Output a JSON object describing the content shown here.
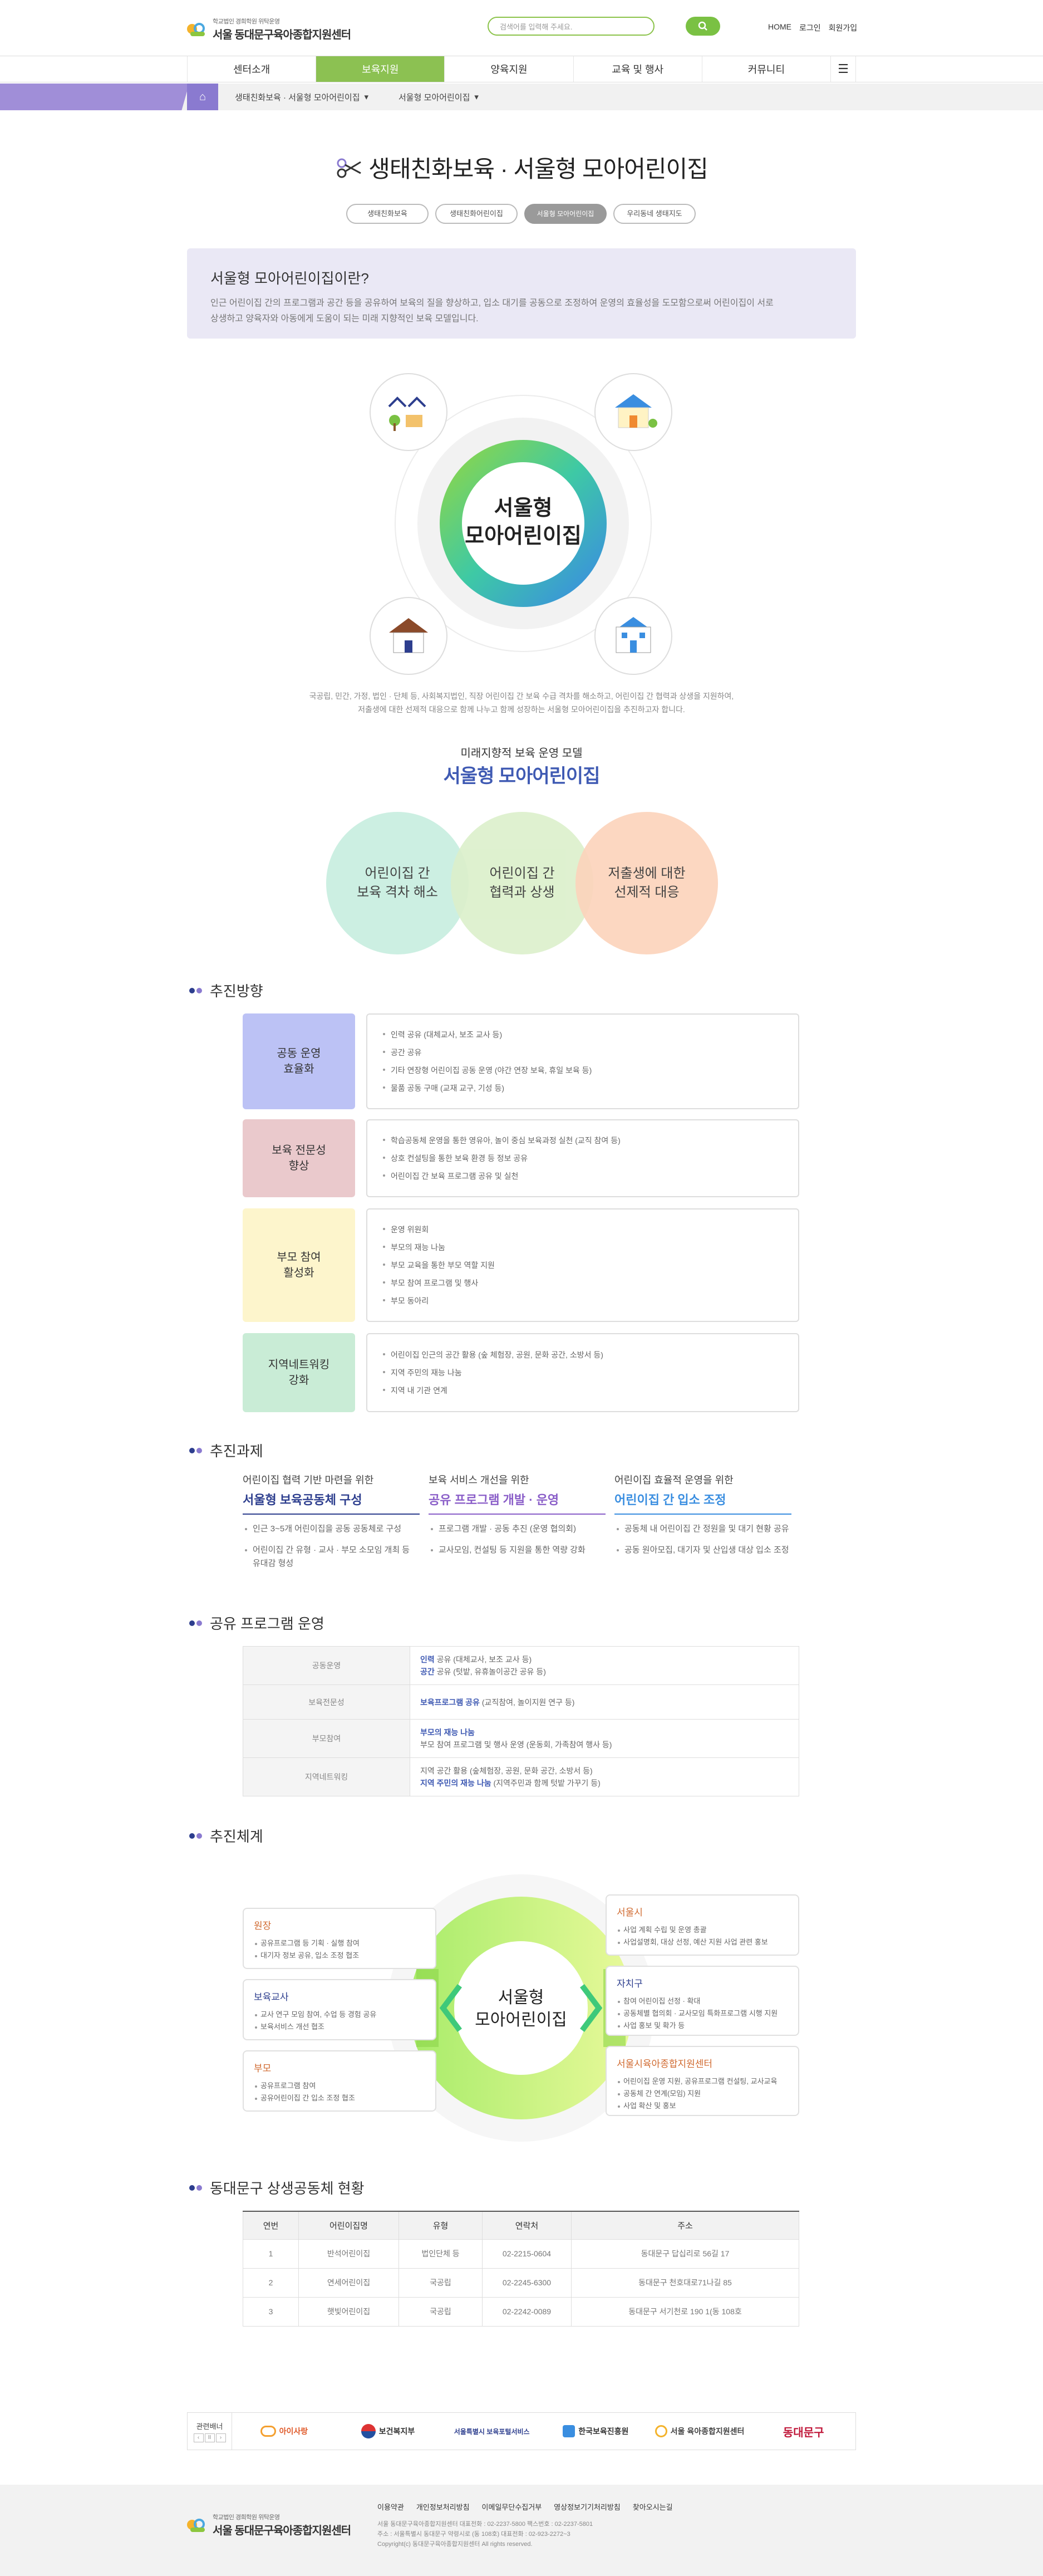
{
  "header": {
    "logo_small": "학교법인 경희학원 위탁운영",
    "logo_main": "서울 동대문구육아종합지원센터",
    "search_placeholder": "검색어를 입력해 주세요.",
    "util": [
      "HOME",
      "로그인",
      "회원가입"
    ]
  },
  "gnb": [
    "센터소개",
    "보육지원",
    "양육지원",
    "교육 및 행사",
    "커뮤니티"
  ],
  "breadcrumb": [
    "생태친화보육 · 서울형 모아어린이집",
    "서울형 모아어린이집"
  ],
  "page_title": "생태친화보육 · 서울형 모아어린이집",
  "subtabs": [
    "생태친화보육",
    "생태친화어린이집",
    "서울형 모아어린이집",
    "우리동네 생태지도"
  ],
  "intro": {
    "heading": "서울형 모아어린이집이란?",
    "text1": "인근 어린이집 간의 프로그램과 공간 등을 공유하여 보육의 질을 향상하고, 입소 대기를 공동으로 조정하여 운영의 효율성을 도모함으로써 어린이집이 서로",
    "text2": "상생하고 양육자와 아동에게 도움이 되는 미래 지향적인 보육 모델입니다."
  },
  "diagram": {
    "center1": "서울형",
    "center2": "모아어린이집",
    "note1": "국공립, 민간, 가정, 법인 · 단체 등, 사회복지법인, 직장 어린이집 간 보육 수급 격차를 해소하고, 어린이집 간 협력과 상생을 지원하여,",
    "note2": "저출생에 대한 선제적 대응으로 함께 나누고 함께 성장하는 서울형 모아어린이집을 추진하고자 합니다."
  },
  "model": {
    "sub": "미래지향적 보육 운영 모델",
    "title": "서울형 모아어린이집",
    "circles": [
      "어린이집 간\n보육 격차 해소",
      "어린이집 간\n협력과 상생",
      "저출생에 대한\n선제적 대응"
    ]
  },
  "sections": {
    "direction": "추진방향",
    "tasks": "추진과제",
    "shared": "공유 프로그램 운영",
    "system": "추진체계",
    "status": "동대문구 상생공동체 현황"
  },
  "direction_rows": [
    {
      "label": "공동 운영\n효율화",
      "items": [
        "인력 공유 (대체교사, 보조 교사 등)",
        "공간 공유",
        "기타 연장형 어린이집 공동 운영 (야간 연장 보육, 휴일 보육 등)",
        "물품 공동 구매 (교재 교구, 기성 등)"
      ]
    },
    {
      "label": "보육 전문성\n향상",
      "items": [
        "학습공동체 운영을 통한 영유아, 놀이 중심 보육과정 실천 (교직 참여 등)",
        "상호 컨설팅을 통한 보육 환경 등 정보 공유",
        "어린이집 간 보육 프로그램 공유 및 실천"
      ]
    },
    {
      "label": "부모 참여\n활성화",
      "items": [
        "운영 위원회",
        "부모의 재능 나눔",
        "부모 교육을 통한 부모 역할 지원",
        "부모 참여 프로그램 및 행사",
        "부모 동아리"
      ]
    },
    {
      "label": "지역네트워킹\n강화",
      "items": [
        "어린이집 인근의 공간 활용 (숲 체험장, 공원, 문화 공간, 소방서 등)",
        "지역 주민의 재능 나눔",
        "지역 내 기관 연계"
      ]
    }
  ],
  "tasks": [
    {
      "t1": "어린이집 협력 기반 마련을 위한",
      "t2": "서울형 보육공동체 구성",
      "items": [
        "인근 3~5개 어린이집을 공동 공동체로 구성",
        "어린이집 간 유형 · 교사 · 부모 소모임 개최 등 유대감 형성"
      ]
    },
    {
      "t1": "보육 서비스 개선을 위한",
      "t2": "공유 프로그램 개발 · 운영",
      "items": [
        "프로그램 개발 · 공동 추진 (운영 협의회)",
        "교사모임, 컨설팅 등 지원을 통한 역량 강화"
      ]
    },
    {
      "t1": "어린이집 효율적 운영을 위한",
      "t2": "어린이집 간 입소 조정",
      "items": [
        "공동체 내 어린이집 간 정원을 및 대기 현황 공유",
        "공동 원아모집, 대기자 및 산입생 대상 입소 조정"
      ]
    }
  ],
  "shared_rows": [
    {
      "k": "공동운영",
      "l1b": "인력",
      "l1": " 공유 (대체교사, 보조 교사 등)",
      "l2b": "공간",
      "l2": " 공유 (텃밭, 유휴놀이공간 공유 등)"
    },
    {
      "k": "보육전문성",
      "l1b": "보육프로그램 공유",
      "l1": " (교직참여, 놀이지원 연구 등)",
      "l2b": "",
      "l2": ""
    },
    {
      "k": "부모참여",
      "l1b": "부모의 재능 나눔",
      "l1": "",
      "l2b": "",
      "l2": "부모 참여 프로그램 및 행사 운영 (운동회, 가족참여 행사 등)"
    },
    {
      "k": "지역네트워킹",
      "l1b": "",
      "l1": "지역 공간 활용 (숲체험장, 공원, 문화 공간, 소방서 등)",
      "l2b": "지역 주민의 재능 나눔",
      "l2": " (지역주민과 함께 텃밭 가꾸기 등)"
    }
  ],
  "system": {
    "center1": "서울형",
    "center2": "모아어린이집",
    "left": [
      {
        "title": "원장",
        "items": [
          "공유프로그램 등 기획 · 실행 참여",
          "대기자 정보 공유, 입소 조정 협조"
        ]
      },
      {
        "title": "보육교사",
        "items": [
          "교사 연구 모임 참여, 수업 등 경험 공유",
          "보육서비스 개선 협조"
        ]
      },
      {
        "title": "부모",
        "items": [
          "공유프로그램 참여",
          "공유어린이집 간 입소 조정 협조"
        ]
      }
    ],
    "right": [
      {
        "title": "서울시",
        "items": [
          "사업 계획 수립 및 운영 총괄",
          "사업설명회, 대상 선정, 예산 지원 사업 관련 홍보"
        ]
      },
      {
        "title": "자치구",
        "items": [
          "참여 어린이집 선정 · 확대",
          "공동체별 협의회 · 교사모임 특화프로그램 시행 지원",
          "사업 홍보 및 확가 등"
        ]
      },
      {
        "title": "서울시육아종합지원센터",
        "items": [
          "어린이집 운영 지원, 공유프로그램 컨설팅, 교사교육",
          "공동체 간 연계(모임) 지원",
          "사업 확산 및 홍보"
        ]
      }
    ]
  },
  "status_table": {
    "headers": [
      "연번",
      "어린이집명",
      "유형",
      "연락처",
      "주소"
    ],
    "rows": [
      [
        "1",
        "반석어린이집",
        "법인단체 등",
        "02-2215-0604",
        "동대문구 답십리로 56길 17"
      ],
      [
        "2",
        "연세어린이집",
        "국공립",
        "02-2245-6300",
        "동대문구 천호대로71나길 85"
      ],
      [
        "3",
        "햇빛어린이집",
        "국공립",
        "02-2242-0089",
        "동대문구 서기천로 190 1(동 108호"
      ]
    ]
  },
  "partners": {
    "label": "관련배너",
    "logos": [
      "아이사랑",
      "보건복지부",
      "서울특별시 보육포털서비스",
      "한국보육진흥원",
      "서울 육아종합지원센터",
      "동대문구"
    ]
  },
  "footer": {
    "links": [
      "이용약관",
      "개인정보처리방침",
      "이메일무단수집거부",
      "영상정보기기처리방침",
      "찾아오시는길"
    ],
    "addr1": "서울 동대문구육아종합지원센터 대표전화 : 02-2237-5800  팩스번호 : 02-2237-5801",
    "addr2": "주소 : 서울특별시 동대문구 약령시로  (동 108호)  대표전화 : 02-923-2272~3",
    "copy": "Copyright(c) 동대문구육아종합지원센터 All rights reserved.",
    "logo_small": "학교법인 경희학원 위탁운영",
    "logo_main": "서울 동대문구육아종합지원센터"
  },
  "colors": {
    "brand_green": "#8cc152",
    "accent_blue": "#3f5ab3",
    "purple": "#a08ed8"
  }
}
